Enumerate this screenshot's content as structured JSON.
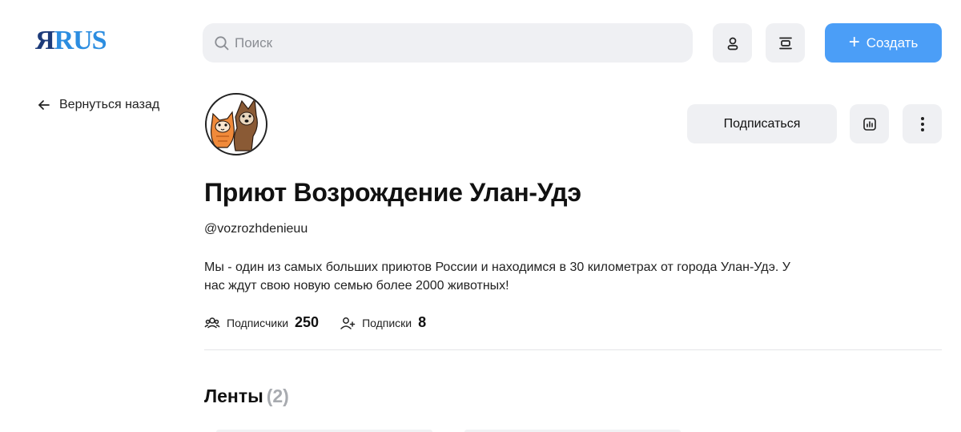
{
  "header": {
    "logo_part1": "Я",
    "logo_part2": "RUS",
    "search_placeholder": "Поиск",
    "create_label": "Создать",
    "create_color": "#4b9ef7"
  },
  "nav": {
    "back_label": "Вернуться назад"
  },
  "profile": {
    "title": "Приют Возрождение Улан-Удэ",
    "handle": "@vozrozhdenieuu",
    "description": "Мы - один из самых больших приютов России и находимся в 30 километрах от города Улан-Удэ. У нас ждут свою новую семью более 2000 животных!",
    "subscribe_label": "Подписаться",
    "stats": {
      "subscribers_label": "Подписчики",
      "subscribers_count": "250",
      "subscriptions_label": "Подписки",
      "subscriptions_count": "8"
    }
  },
  "feeds": {
    "title": "Ленты",
    "count": "(2)"
  },
  "icons": {
    "search": "search-icon",
    "profile": "user-icon",
    "feed": "feed-icon",
    "back": "arrow-left-icon",
    "stats": "chart-icon",
    "more": "more-vertical-icon",
    "subscribers": "users-icon",
    "subscriptions": "user-plus-icon"
  }
}
